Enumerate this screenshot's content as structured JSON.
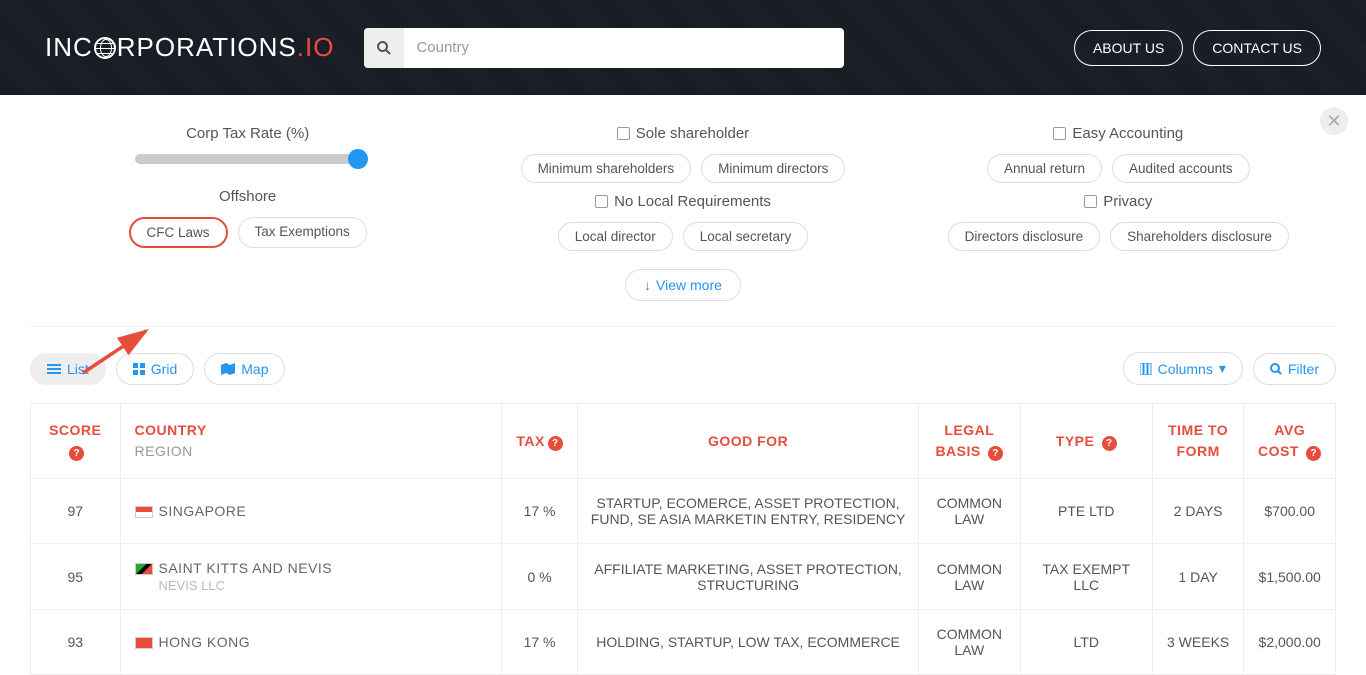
{
  "logo": {
    "pre": "INC",
    "mid": "RPORATIONS",
    "io": ".IO"
  },
  "search": {
    "placeholder": "Country"
  },
  "nav": {
    "about": "ABOUT US",
    "contact": "CONTACT US"
  },
  "filters": {
    "col1": {
      "title1": "Corp Tax Rate (%)",
      "title2": "Offshore",
      "pills2": [
        "CFC Laws",
        "Tax Exemptions"
      ]
    },
    "col2": {
      "title1": "Sole shareholder",
      "pills1": [
        "Minimum shareholders",
        "Minimum directors"
      ],
      "title2": "No Local Requirements",
      "pills2": [
        "Local director",
        "Local secretary"
      ],
      "view_more": "View more"
    },
    "col3": {
      "title1": "Easy Accounting",
      "pills1": [
        "Annual return",
        "Audited accounts"
      ],
      "title2": "Privacy",
      "pills2": [
        "Directors disclosure",
        "Shareholders disclosure"
      ]
    }
  },
  "tabs": {
    "list": "List",
    "grid": "Grid",
    "map": "Map",
    "columns": "Columns",
    "filter": "Filter"
  },
  "headers": {
    "score": "SCORE",
    "country": "COUNTRY",
    "region": "REGION",
    "tax": "TAX",
    "good_for": "GOOD FOR",
    "legal": "LEGAL BASIS",
    "type": "TYPE",
    "time": "TIME TO FORM",
    "cost": "AVG COST"
  },
  "rows": [
    {
      "score": "97",
      "country": "SINGAPORE",
      "region": "",
      "flag": "sg",
      "tax": "17 %",
      "good_for": "STARTUP, ECOMERCE, ASSET PROTECTION, FUND, SE ASIA MARKETIN ENTRY, RESIDENCY",
      "legal": "COMMON LAW",
      "type": "PTE LTD",
      "time": "2 DAYS",
      "cost": "$700.00"
    },
    {
      "score": "95",
      "country": "SAINT KITTS AND NEVIS",
      "region": "NEVIS LLC",
      "flag": "kn",
      "tax": "0 %",
      "good_for": "AFFILIATE MARKETING, ASSET PROTECTION, STRUCTURING",
      "legal": "COMMON LAW",
      "type": "TAX EXEMPT LLC",
      "time": "1 DAY",
      "cost": "$1,500.00"
    },
    {
      "score": "93",
      "country": "HONG KONG",
      "region": "",
      "flag": "hk",
      "tax": "17 %",
      "good_for": "HOLDING, STARTUP, LOW TAX, ECOMMERCE",
      "legal": "COMMON LAW",
      "type": "LTD",
      "time": "3 WEEKS",
      "cost": "$2,000.00"
    }
  ]
}
